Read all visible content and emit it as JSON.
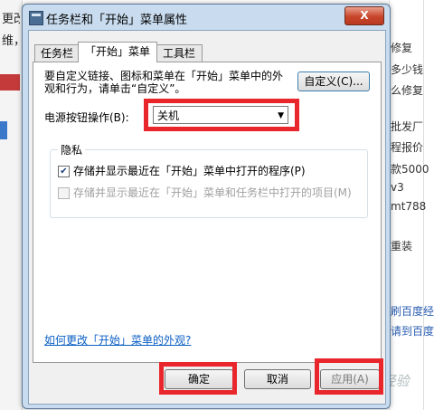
{
  "background": {
    "left_lines": [
      "更改",
      "维，"
    ],
    "right_lines": [
      "修复",
      "多少钱",
      "么修复",
      "批发厂",
      "程报价",
      "款5000",
      "v3",
      "mt788",
      "重装"
    ],
    "right_links": [
      "刷百度经",
      "请到百度"
    ],
    "watermark": "Baidu经验"
  },
  "dialog": {
    "title": "任务栏和「开始」菜单属性",
    "close_label": "X",
    "tabs": [
      "任务栏",
      "「开始」菜单",
      "工具栏"
    ],
    "active_tab": 1,
    "description": "要自定义链接、图标和菜单在「开始」菜单中的外观和行为，请单击“自定义”。",
    "customize_label": "自定义(C)...",
    "power_label": "电源按钮操作(B):",
    "power_value": "关机",
    "privacy_title": "隐私",
    "privacy_items": [
      {
        "label": "存储并显示最近在「开始」菜单中打开的程序(P)",
        "checked": true,
        "enabled": true
      },
      {
        "label": "存储并显示最近在「开始」菜单和任务栏中打开的项目(M)",
        "checked": false,
        "enabled": false
      }
    ],
    "help_link": "如何更改「开始」菜单的外观?",
    "ok_label": "确定",
    "cancel_label": "取消",
    "apply_label": "应用(A)"
  },
  "colors": {
    "highlight": "#e8262b",
    "link": "#0b5fc4"
  }
}
